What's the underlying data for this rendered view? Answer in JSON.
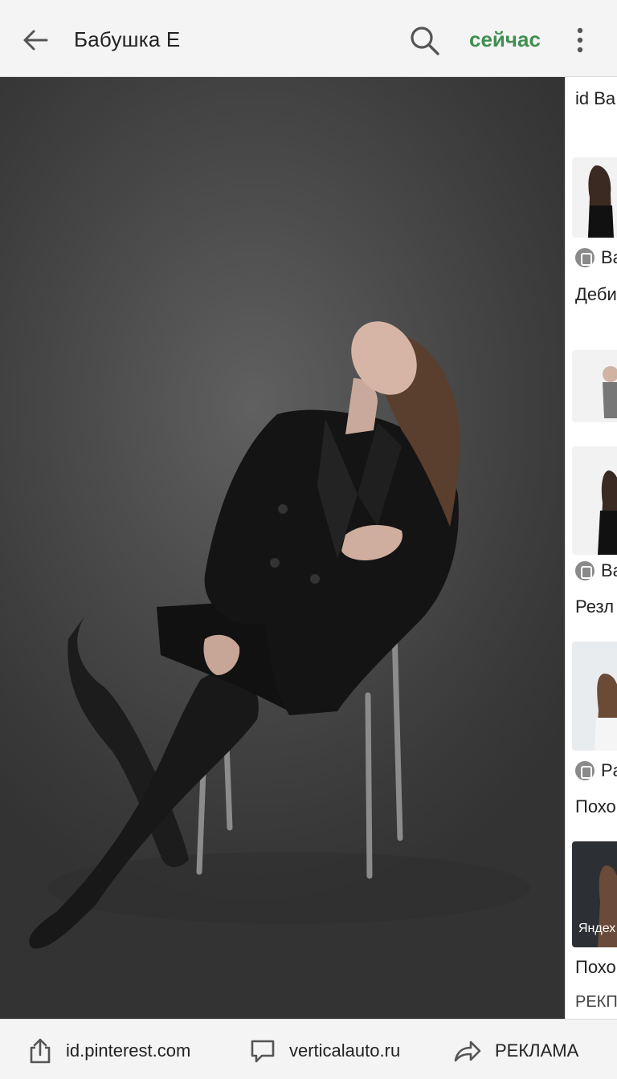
{
  "header": {
    "title": "Бабушка Е",
    "time_label": "сейчас",
    "accent_color": "#3f8f4f"
  },
  "photo": {
    "carousel_total": 6,
    "carousel_active": 1
  },
  "sidebar": {
    "heading": "id Ba",
    "items": [
      {
        "source": "Ba",
        "caption": "Деби"
      },
      {
        "source": "Ba",
        "caption": "Резл"
      },
      {
        "source": "Pa",
        "caption": "Похо"
      },
      {
        "watermark": "Яндех",
        "caption": "Похо"
      },
      {
        "caption": "РЕКП"
      }
    ]
  },
  "bottombar": {
    "share_label": "id.pinterest.com",
    "comment_label": "verticalauto.ru",
    "forward_label": "РЕКЛАМА"
  }
}
